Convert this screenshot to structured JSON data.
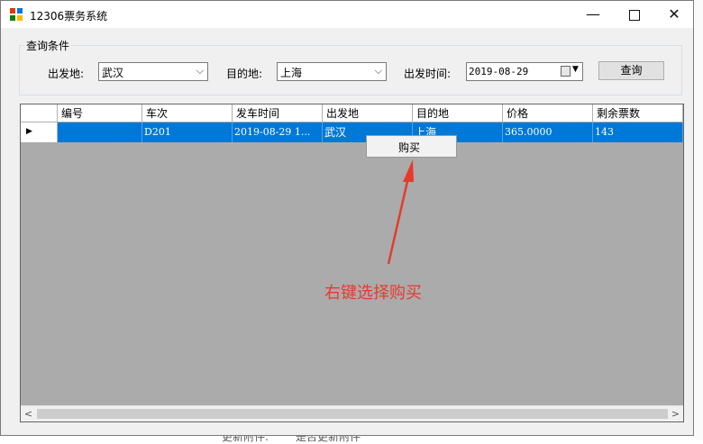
{
  "window": {
    "title": "12306票务系统",
    "min_glyph": "—",
    "close_glyph": "✕"
  },
  "query": {
    "group_label": "查询条件",
    "from_label": "出发地:",
    "from_value": "武汉",
    "to_label": "目的地:",
    "to_value": "上海",
    "date_label": "出发时间:",
    "date_value": "2019-08-29",
    "query_button": "查询"
  },
  "grid": {
    "columns": [
      "编号",
      "车次",
      "发车时间",
      "出发地",
      "目的地",
      "价格",
      "剩余票数"
    ],
    "rows": [
      {
        "id": "",
        "train": "D201",
        "depart_time": "2019-08-29 1...",
        "from": "武汉",
        "to": "上海",
        "price": "365.0000",
        "remaining": "143"
      }
    ]
  },
  "context_menu": {
    "items": [
      "购买"
    ]
  },
  "annotation": {
    "text": "右键选择购买",
    "color": "#e53b2c"
  },
  "background_text": {
    "a": "更新附件:",
    "b": "是否更新附件"
  },
  "colors": {
    "selection": "#0078d7",
    "grid_bg": "#ababab"
  }
}
